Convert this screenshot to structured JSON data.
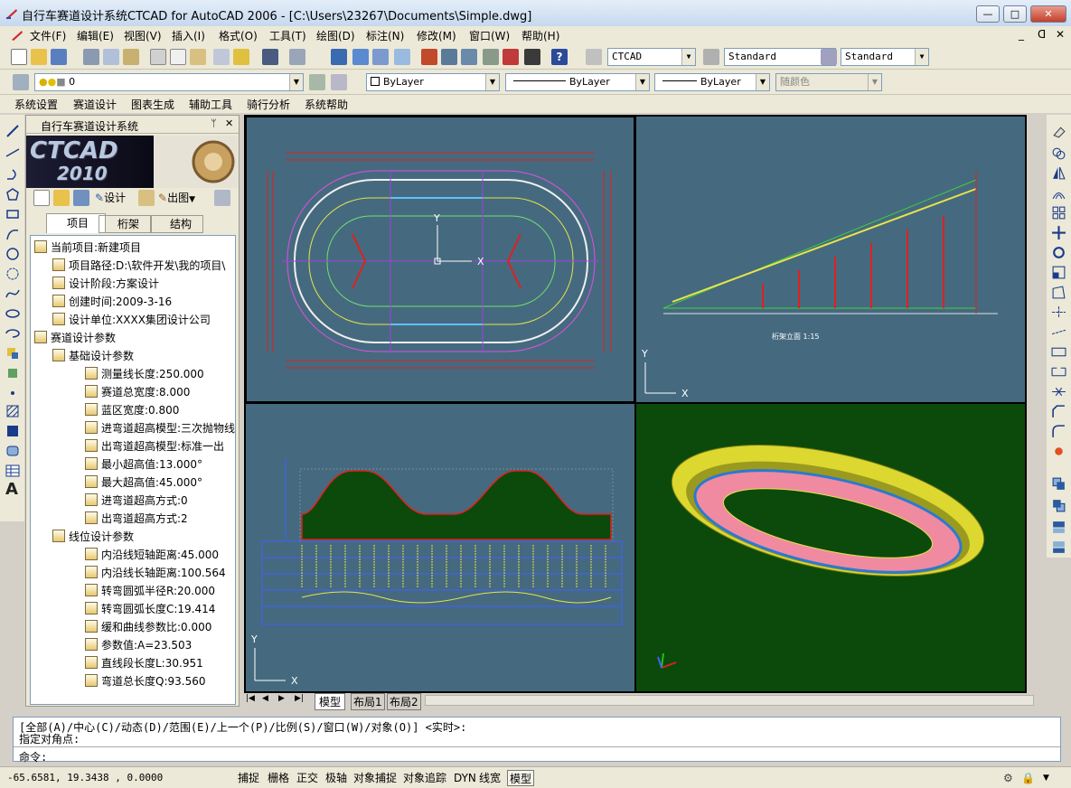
{
  "window": {
    "title": "自行车赛道设计系统CTCAD for AutoCAD 2006 - [C:\\Users\\23267\\Documents\\Simple.dwg]",
    "min_label": "—",
    "max_label": "□",
    "close_label": "✕",
    "doc_min": "_",
    "doc_restore": "ᗡ",
    "doc_close": "✕"
  },
  "menu": [
    "文件(F)",
    "编辑(E)",
    "视图(V)",
    "插入(I)",
    "格式(O)",
    "工具(T)",
    "绘图(D)",
    "标注(N)",
    "修改(M)",
    "窗口(W)",
    "帮助(H)"
  ],
  "toolbar2": {
    "text_style": "CTCAD",
    "dim_style": "Standard",
    "table_style": "Standard"
  },
  "toolbar3": {
    "layer": "0",
    "color": "ByLayer",
    "linetype": "ByLayer",
    "lineweight": "ByLayer",
    "plotstyle": "随颜色"
  },
  "custom_menu": [
    "系统设置",
    "赛道设计",
    "图表生成",
    "辅助工具",
    "骑行分析",
    "系统帮助"
  ],
  "panel": {
    "title": "自行车赛道设计系统",
    "pin": "ᛘ",
    "close": "✕",
    "logo_text": "CTCAD",
    "logo_year": "2010",
    "design_btn": "设计",
    "output_btn": "出图",
    "tabs": [
      "项目",
      "桁架",
      "结构"
    ]
  },
  "tree": [
    {
      "level": 0,
      "label": "当前项目:新建项目"
    },
    {
      "level": 1,
      "label": "项目路径:D:\\软件开发\\我的项目\\"
    },
    {
      "level": 1,
      "label": "设计阶段:方案设计"
    },
    {
      "level": 1,
      "label": "创建时间:2009-3-16"
    },
    {
      "level": 1,
      "label": "设计单位:XXXX集团设计公司"
    },
    {
      "level": 0,
      "label": "赛道设计参数"
    },
    {
      "level": 1,
      "label": "基础设计参数"
    },
    {
      "level": 2,
      "label": "测量线长度:250.000"
    },
    {
      "level": 2,
      "label": "赛道总宽度:8.000"
    },
    {
      "level": 2,
      "label": "蓝区宽度:0.800"
    },
    {
      "level": 2,
      "label": "进弯道超高模型:三次抛物线"
    },
    {
      "level": 2,
      "label": "出弯道超高模型:标准一出"
    },
    {
      "level": 2,
      "label": "最小超高值:13.000°"
    },
    {
      "level": 2,
      "label": "最大超高值:45.000°"
    },
    {
      "level": 2,
      "label": "进弯道超高方式:0"
    },
    {
      "level": 2,
      "label": "出弯道超高方式:2"
    },
    {
      "level": 1,
      "label": "线位设计参数"
    },
    {
      "level": 2,
      "label": "内沿线短轴距离:45.000"
    },
    {
      "level": 2,
      "label": "内沿线长轴距离:100.564"
    },
    {
      "level": 2,
      "label": "转弯圆弧半径R:20.000"
    },
    {
      "level": 2,
      "label": "转弯圆弧长度C:19.414"
    },
    {
      "level": 2,
      "label": "缓和曲线参数比:0.000"
    },
    {
      "level": 2,
      "label": "参数值:A=23.503"
    },
    {
      "level": 2,
      "label": "直线段长度L:30.951"
    },
    {
      "level": 2,
      "label": "弯道总长度Q:93.560"
    }
  ],
  "viewports": {
    "tl_axis_x": "X",
    "tl_axis_y": "Y",
    "tr_axis_x": "X",
    "tr_axis_y": "Y",
    "bl_axis_x": "X",
    "bl_axis_y": "Y",
    "tr_caption": "桁架立面 1:15"
  },
  "layout_tabs": [
    "模型",
    "布局1",
    "布局2"
  ],
  "command": {
    "line1": "[全部(A)/中心(C)/动态(D)/范围(E)/上一个(P)/比例(S)/窗口(W)/对象(O)] <实时>:",
    "line2": "指定对角点:",
    "prompt": "命令:"
  },
  "status": {
    "coords": "-65.6581, 19.3438 , 0.0000",
    "toggles": [
      "捕捉",
      "栅格",
      "正交",
      "极轴",
      "对象捕捉",
      "对象追踪",
      "DYN",
      "线宽",
      "模型"
    ]
  },
  "colors": {
    "viewport_bg": "#456a7f",
    "viewport_3d_bg": "#0b4a0b",
    "track_pink": "#f08aa0",
    "track_yellow": "#e8e45a"
  }
}
